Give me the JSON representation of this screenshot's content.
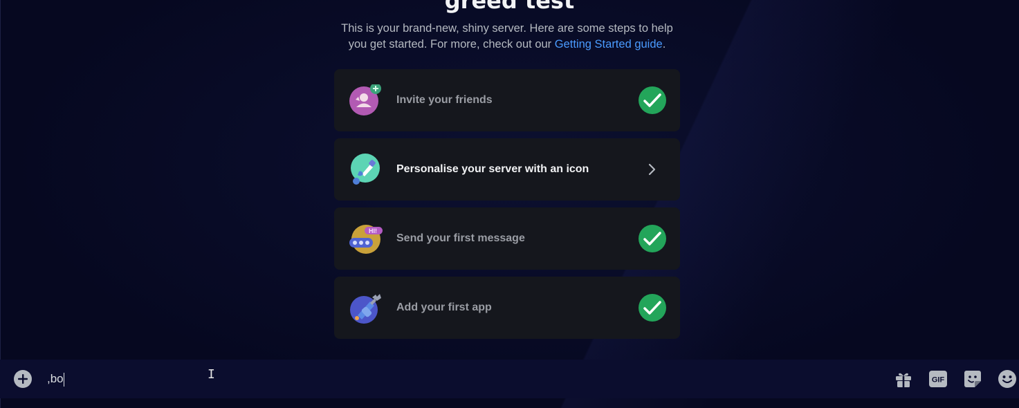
{
  "header": {
    "title": "greed test",
    "subtitle_text": "This is your brand-new, shiny server. Here are some steps to help you get started. For more, check out our ",
    "subtitle_link": "Getting Started guide",
    "subtitle_end": "."
  },
  "cards": [
    {
      "label": "Invite your friends",
      "status": "completed",
      "icon": "invite-friends-icon"
    },
    {
      "label": "Personalise your server with an icon",
      "status": "pending",
      "icon": "paintbrush-icon"
    },
    {
      "label": "Send your first message",
      "status": "completed",
      "icon": "message-icon"
    },
    {
      "label": "Add your first app",
      "status": "completed",
      "icon": "app-icon"
    }
  ],
  "composer": {
    "value": ",bo"
  },
  "toolbar": [
    "gift-icon",
    "gif-icon",
    "sticker-icon",
    "emoji-icon"
  ],
  "colors": {
    "accent_link": "#4a9bff",
    "success": "#23a55a",
    "card_bg": "#15171d"
  }
}
